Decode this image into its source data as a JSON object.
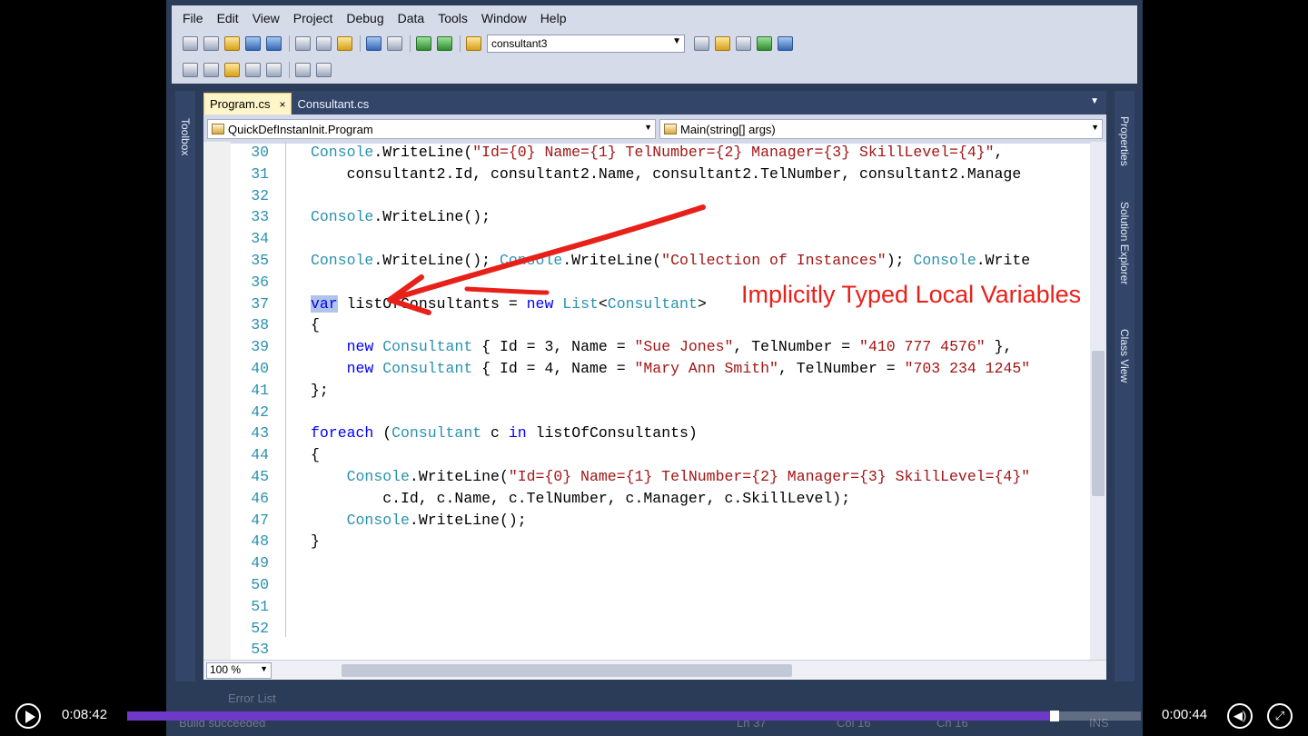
{
  "menu": [
    "File",
    "Edit",
    "View",
    "Project",
    "Debug",
    "Data",
    "Tools",
    "Window",
    "Help"
  ],
  "toolbar": {
    "config_value": "consultant3"
  },
  "side": {
    "left": "Toolbox",
    "right": [
      "Properties",
      "Solution Explorer",
      "Class View"
    ]
  },
  "tabs": [
    {
      "label": "Program.cs",
      "close": "×"
    },
    {
      "label": "Consultant.cs"
    }
  ],
  "nav": {
    "type": "QuickDefInstanInit.Program",
    "member": "Main(string[] args)"
  },
  "annotation": "Implicitly Typed Local Variables",
  "code": [
    {
      "n": "30",
      "html": "<span class='ty'>Console</span>.WriteLine(<span class='st'>\"Id={0} Name={1} TelNumber={2} Manager={3} SkillLevel={4}\"</span>,"
    },
    {
      "n": "31",
      "html": "    consultant2.Id, consultant2.Name, consultant2.TelNumber, consultant2.Manage"
    },
    {
      "n": "32",
      "html": ""
    },
    {
      "n": "33",
      "html": "<span class='ty'>Console</span>.WriteLine();"
    },
    {
      "n": "34",
      "html": ""
    },
    {
      "n": "35",
      "html": "<span class='ty'>Console</span>.WriteLine(); <span class='ty'>Console</span>.WriteLine(<span class='st'>\"Collection of Instances\"</span>); <span class='ty'>Console</span>.Write"
    },
    {
      "n": "36",
      "html": ""
    },
    {
      "n": "37",
      "html": "<span class='kw sel'>var</span> listOfConsultants = <span class='kw'>new</span> <span class='ty'>List</span>&lt;<span class='ty'>Consultant</span>&gt;"
    },
    {
      "n": "38",
      "html": "{"
    },
    {
      "n": "39",
      "html": "    <span class='kw'>new</span> <span class='ty'>Consultant</span> { Id = 3, Name = <span class='st'>\"Sue Jones\"</span>, TelNumber = <span class='st'>\"410 777 4576\"</span> },"
    },
    {
      "n": "40",
      "html": "    <span class='kw'>new</span> <span class='ty'>Consultant</span> { Id = 4, Name = <span class='st'>\"Mary Ann Smith\"</span>, TelNumber = <span class='st'>\"703 234 1245\"</span>"
    },
    {
      "n": "41",
      "html": "};"
    },
    {
      "n": "42",
      "html": ""
    },
    {
      "n": "43",
      "html": "<span class='kw'>foreach</span> (<span class='ty'>Consultant</span> c <span class='kw'>in</span> listOfConsultants)"
    },
    {
      "n": "44",
      "html": "{"
    },
    {
      "n": "45",
      "html": "    <span class='ty'>Console</span>.WriteLine(<span class='st'>\"Id={0} Name={1} TelNumber={2} Manager={3} SkillLevel={4}\"</span>"
    },
    {
      "n": "46",
      "html": "        c.Id, c.Name, c.TelNumber, c.Manager, c.SkillLevel);"
    },
    {
      "n": "47",
      "html": "    <span class='ty'>Console</span>.WriteLine();"
    },
    {
      "n": "48",
      "html": "}"
    },
    {
      "n": "49",
      "html": ""
    },
    {
      "n": "50",
      "html": ""
    },
    {
      "n": "51",
      "html": ""
    },
    {
      "n": "52",
      "html": ""
    },
    {
      "n": "53",
      "html": ""
    }
  ],
  "editor": {
    "zoom": "100 %"
  },
  "status": {
    "error_list": "Error List",
    "build": "Build succeeded",
    "ln": "Ln 37",
    "col": "Col 16",
    "ch": "Ch 16",
    "ins": "INS"
  },
  "player": {
    "elapsed": "0:08:42",
    "remaining": "0:00:44",
    "progress": 0.91
  },
  "colors": {
    "accent": "#6f39c7",
    "annotation": "#e8201a"
  }
}
